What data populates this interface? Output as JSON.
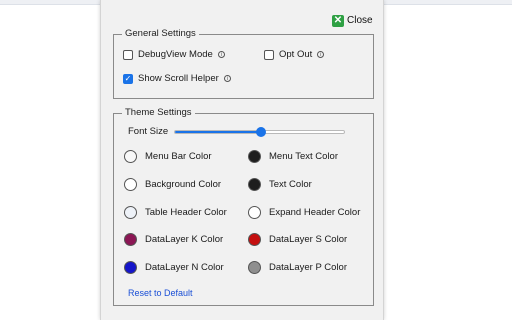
{
  "close_label": "Close",
  "general": {
    "legend": "General Settings",
    "debugview": {
      "label": "DebugView Mode",
      "checked": false
    },
    "optout": {
      "label": "Opt Out",
      "checked": false
    },
    "scroll_helper": {
      "label": "Show Scroll Helper",
      "checked": true
    },
    "info_glyph": "i"
  },
  "theme": {
    "legend": "Theme Settings",
    "font_size_label": "Font Size",
    "font_size_fraction": 0.51,
    "colors": [
      {
        "label": "Menu Bar Color",
        "color": "#f8f8f8"
      },
      {
        "label": "Menu Text Color",
        "color": "#1e1e1e"
      },
      {
        "label": "Background Color",
        "color": "#ffffff"
      },
      {
        "label": "Text Color",
        "color": "#1e1e1e"
      },
      {
        "label": "Table Header Color",
        "color": "#eef2f8"
      },
      {
        "label": "Expand Header Color",
        "color": "#ffffff"
      },
      {
        "label": "DataLayer K Color",
        "color": "#8b1654"
      },
      {
        "label": "DataLayer S Color",
        "color": "#c40f0f"
      },
      {
        "label": "DataLayer N Color",
        "color": "#1515c9"
      },
      {
        "label": "DataLayer P Color",
        "color": "#8f8f8f"
      }
    ],
    "reset_label": "Reset to Default"
  },
  "colors": {
    "accent": "#1a73e8",
    "close_icon": "#2ea043",
    "link": "#1a4fd6"
  }
}
